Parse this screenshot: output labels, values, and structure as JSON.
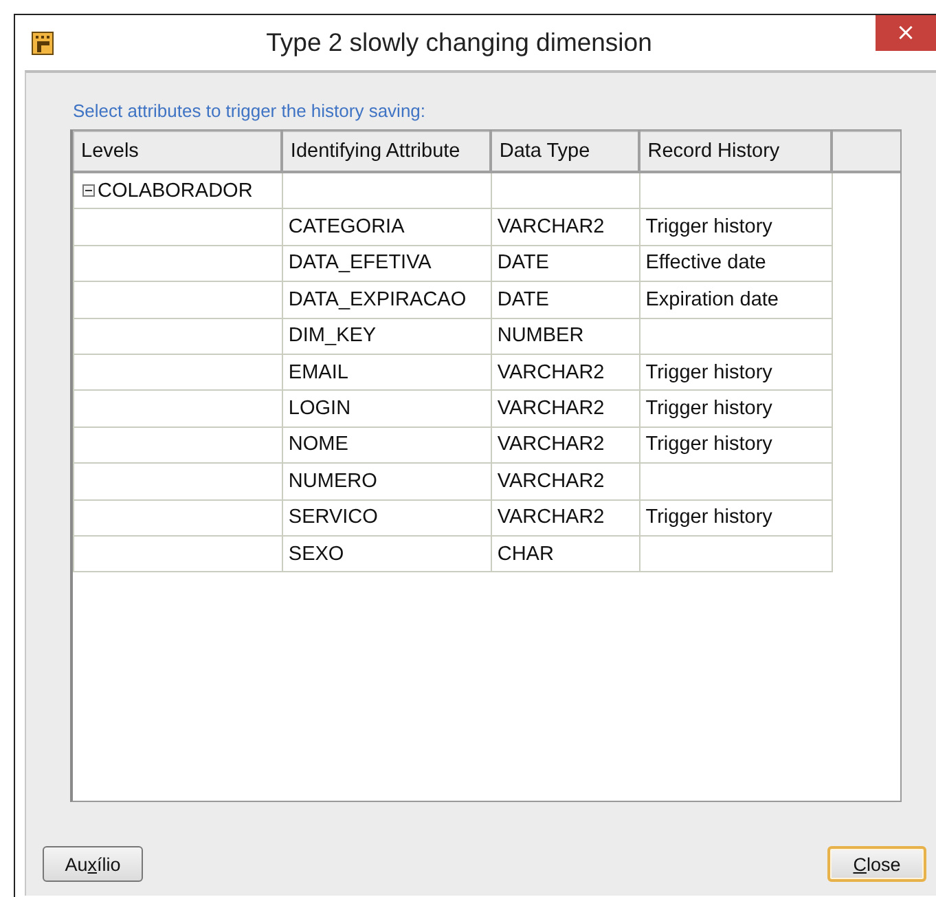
{
  "window": {
    "title": "Type 2 slowly changing dimension",
    "close_label": "×"
  },
  "instruction": "Select attributes to trigger the history saving:",
  "table": {
    "columns": [
      "Levels",
      "Identifying Attribute",
      "Data Type",
      "Record History"
    ],
    "rows": [
      {
        "level": "COLABORADOR",
        "expanded": true,
        "children": [
          {
            "attribute": "CATEGORIA",
            "data_type": "VARCHAR2",
            "record_history": "Trigger history"
          },
          {
            "attribute": "DATA_EFETIVA",
            "data_type": "DATE",
            "record_history": "Effective date"
          },
          {
            "attribute": "DATA_EXPIRACAO",
            "data_type": "DATE",
            "record_history": "Expiration date"
          },
          {
            "attribute": "DIM_KEY",
            "data_type": "NUMBER"
          },
          {
            "attribute": "EMAIL",
            "data_type": "VARCHAR2",
            "record_history": "Trigger history"
          },
          {
            "attribute": "LOGIN",
            "data_type": "VARCHAR2",
            "record_history": "Trigger history"
          },
          {
            "attribute": "NOME",
            "data_type": "VARCHAR2",
            "record_history": "Trigger history"
          },
          {
            "attribute": "NUMERO",
            "data_type": "VARCHAR2"
          },
          {
            "attribute": "SERVICO",
            "data_type": "VARCHAR2",
            "record_history": "Trigger history"
          },
          {
            "attribute": "SEXO",
            "data_type": "CHAR"
          }
        ]
      }
    ]
  },
  "buttons": [
    {
      "label_before": "Au",
      "access_key": "x",
      "label_after": "ílio",
      "default": false
    },
    {
      "access_key": "C",
      "label_after": "lose",
      "default": true
    }
  ]
}
